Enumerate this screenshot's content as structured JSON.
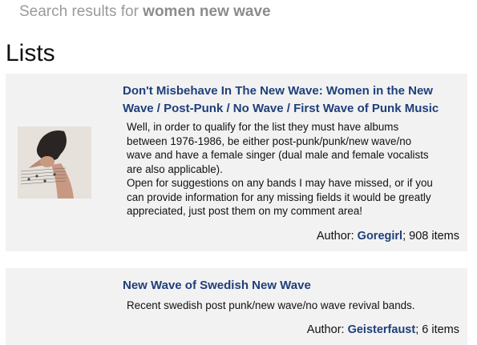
{
  "search": {
    "prefix": "Search results for ",
    "query": "women new wave"
  },
  "section": {
    "title": "Lists"
  },
  "lists": [
    {
      "title": "Don't Misbehave In The New Wave: Women in the New Wave / Post-Punk / No Wave / First Wave of Punk Music",
      "description_lines": [
        "Well, in order to qualify for the list they must have albums between 1976-1986, be either post-punk/punk/new wave/no wave and have a female singer (dual male and female vocalists are also applicable).",
        "Open for suggestions on any bands I may have missed, or if you can provide information for any missing fields it would be greatly appreciated, just post them on my comment area!"
      ],
      "author_label": "Author: ",
      "author": "Goregirl",
      "items": "; 908 items"
    },
    {
      "title": "New Wave of Swedish New Wave",
      "description_lines": [
        "Recent swedish post punk/new wave/no wave revival bands."
      ],
      "author_label": "Author: ",
      "author": "Geisterfaust",
      "items": "; 6 items"
    }
  ]
}
